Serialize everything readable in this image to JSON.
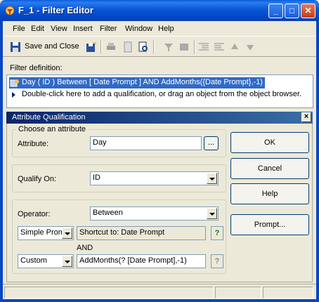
{
  "window": {
    "title": "F_1 - Filter Editor"
  },
  "menu": [
    {
      "label": "File",
      "key": "F"
    },
    {
      "label": "Edit",
      "key": "E"
    },
    {
      "label": "View",
      "key": "V"
    },
    {
      "label": "Insert",
      "key": "I"
    },
    {
      "label": "Filter",
      "key": "t"
    },
    {
      "label": "Window",
      "key": "W"
    },
    {
      "label": "Help",
      "key": "H"
    }
  ],
  "toolbar": {
    "save_close_label": "Save and Close"
  },
  "filter_definition": {
    "label": "Filter definition:",
    "selected_line": "Day ( ID ) Between [ Date Prompt ] AND AddMonths({Date Prompt},-1)",
    "hint_line": "Double-click here to add a qualification, or drag an object from the object browser."
  },
  "attribute_qualification": {
    "header": "Attribute Qualification",
    "choose_group": "Choose an attribute",
    "attribute_label": "Attribute:",
    "attribute_value": "Day",
    "browse_label": "...",
    "qualify_on_label": "Qualify On:",
    "qualify_on_value": "ID",
    "operator_label": "Operator:",
    "operator_value": "Between",
    "value1_type": "Simple Prom",
    "value1_text": "Shortcut to: Date Prompt",
    "and_label": "AND",
    "value2_type": "Custom",
    "value2_text": "AddMonths(? [Date Prompt],-1)",
    "help_symbol": "?"
  },
  "buttons": {
    "ok": "OK",
    "cancel": "Cancel",
    "help": "Help",
    "prompt": "Prompt..."
  },
  "colors": {
    "titlebar": "#0857d6",
    "selection": "#316ac5",
    "panel_header": "#0a246a",
    "window_bg": "#ece9d8"
  }
}
